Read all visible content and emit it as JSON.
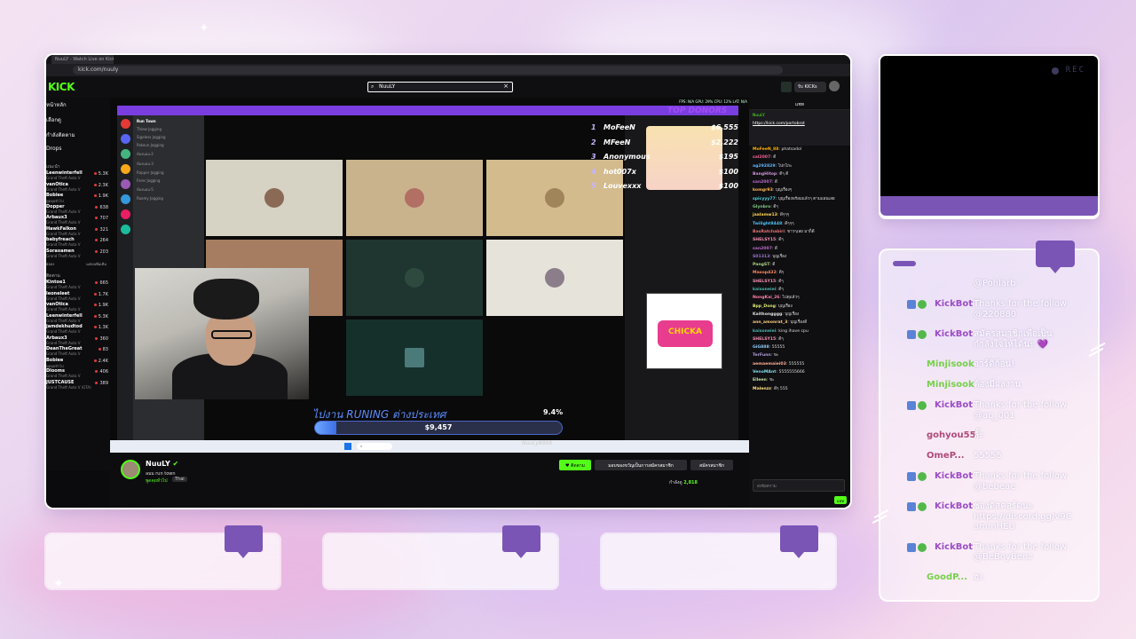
{
  "browser": {
    "tab_title": "NuuLY - Watch Live on Kick",
    "url": "kick.com/nuuly"
  },
  "kick": {
    "logo": "KICK",
    "search_value": "NuuLY",
    "join_label": "รับ KICKs"
  },
  "sidebar": {
    "nav": [
      "หน้าหลัก",
      "เลือกดู",
      "กำลังติดตาม",
      "Drops"
    ],
    "section_recommended": "แนะนำ",
    "channels_top": [
      {
        "name": "Leenwinterfell",
        "game": "Grand Theft Auto V",
        "count": "5.3K"
      },
      {
        "name": "vanOtica",
        "game": "Grand Theft Auto V",
        "count": "2.3K"
      },
      {
        "name": "Bobiee",
        "game": "พูดคุยทั่วไป",
        "count": "1.9K"
      },
      {
        "name": "Dopper",
        "game": "Grand Theft Auto V",
        "count": "638"
      },
      {
        "name": "Arbaux3",
        "game": "Grand Theft Auto V",
        "count": "707"
      },
      {
        "name": "HawkFalkon",
        "game": "Grand Theft Auto V",
        "count": "321"
      },
      {
        "name": "babyfreach",
        "game": "Grand Theft Auto V",
        "count": "264"
      },
      {
        "name": "Soraxamen",
        "game": "Grand Theft Auto V",
        "count": "203"
      }
    ],
    "show_more": "แสดงเพิ่มเติม",
    "show_less": "ย่อลง",
    "section_following": "ติดตาม",
    "channels_bottom": [
      {
        "name": "Kintoe1",
        "game": "Grand Theft Auto V",
        "count": "665"
      },
      {
        "name": "leoneleet",
        "game": "Grand Theft Auto V",
        "count": "1.7K"
      },
      {
        "name": "vanOtica",
        "game": "Grand Theft Auto V",
        "count": "1.9K"
      },
      {
        "name": "Leenwinterfell",
        "game": "Grand Theft Auto V",
        "count": "5.3K"
      },
      {
        "name": "jamdekhudtod",
        "game": "Grand Theft Auto V",
        "count": "1.3K"
      },
      {
        "name": "Arbaux3",
        "game": "Grand Theft Auto V",
        "count": "360"
      },
      {
        "name": "DeanTheGreat",
        "game": "Grand Theft Auto V",
        "count": "83"
      },
      {
        "name": "Bobiee",
        "game": "พูดคุยทั่วไป",
        "count": "2.4K"
      },
      {
        "name": "Dlooms",
        "game": "Grand Theft Auto V",
        "count": "406"
      },
      {
        "name": "JUSTCAUSE",
        "game": "Grand Theft Auto V (GTA)",
        "count": "389"
      }
    ]
  },
  "stream": {
    "top_donors_title": "TOP DONORS",
    "donors": [
      {
        "rank": "1",
        "name": "MoFeeN",
        "amount": "$6,555"
      },
      {
        "rank": "2",
        "name": "MFeeN",
        "amount": "$2,222"
      },
      {
        "rank": "3",
        "name": "Anonymous",
        "amount": "$195"
      },
      {
        "rank": "4",
        "name": "hot007x",
        "amount": "$100"
      },
      {
        "rank": "5",
        "name": "Louvexxx",
        "amount": "$100"
      }
    ],
    "discord_server": "Run Town",
    "discord_channels": [
      "Thiew Jogging",
      "Sigeless Jogging",
      "Pakoun Jogging",
      "ห้องนอน-2",
      "ห้องนอน-3",
      "Rapper Jogging",
      "Ferer Jogging",
      "ห้องนอน-5",
      "Roomy Jogging"
    ],
    "goal_label": "ไปงาน RUNING ต่างประเทศ",
    "goal_percent": "9.4%",
    "goal_fraction": 0.094,
    "goal_amount": "$9,457",
    "watermark": "NuuLy8888",
    "stats": "FPS: N/A   GPU: 29%   CPU: 12%   LAT: N/A",
    "chicka_logo": "CHICKA"
  },
  "channel": {
    "name": "NuuLY",
    "title": "ลมม run town",
    "category": "พูดคุยทั่วไป",
    "tag": "Thai",
    "follow_label": "ติดตาม",
    "gift_label": "มอบของขวัญเป็นการสมัครสมาชิก",
    "subscribe_label": "สมัครสมาชิก",
    "viewers_prefix": "กำลังดู",
    "viewers": "2,818"
  },
  "kick_chat": {
    "header": "แชท",
    "pinned_user": "NuuLY",
    "pinned_link": "https://kick.com/portobrot",
    "input_placeholder": "ส่งข้อความ",
    "send_label": "แชท",
    "messages": [
      {
        "user": "MoFeeN_88",
        "text": "phatsadol",
        "color": "#ffb300"
      },
      {
        "user": "sal2007",
        "text": "ดี",
        "color": "#f06292"
      },
      {
        "user": "ag292829",
        "text": "โปกโกะ",
        "color": "#64b5f6"
      },
      {
        "user": "BangHitop",
        "text": "ดีๆ ดี",
        "color": "#ce93d8"
      },
      {
        "user": "san2007",
        "text": "ดี",
        "color": "#ba68c8"
      },
      {
        "user": "komgr93",
        "text": "บุญเรื่องๆ",
        "color": "#ffb74d"
      },
      {
        "user": "spicyyy77",
        "text": "บุญเรื่องพร้อมแล้วๆ ตามแผนเลย",
        "color": "#4dd0e1"
      },
      {
        "user": "Glynbro",
        "text": "ดีๆ",
        "color": "#81c784"
      },
      {
        "user": "jaalamw13",
        "text": "ดีๆๆๆ",
        "color": "#ffd54f"
      },
      {
        "user": "Twilight8448",
        "text": "ดีๆๆๆ",
        "color": "#4fc3f7"
      },
      {
        "user": "BasRatchabiri",
        "text": "ขาวๆเลย มาก็ดี",
        "color": "#e57373"
      },
      {
        "user": "SHELSY15",
        "text": "ดีๆ",
        "color": "#f48fb1"
      },
      {
        "user": "san2007",
        "text": "ดี",
        "color": "#ba68c8"
      },
      {
        "user": "S01313",
        "text": "บุญเรื่อง",
        "color": "#9575cd"
      },
      {
        "user": "PangST",
        "text": "ดี",
        "color": "#aed581"
      },
      {
        "user": "Maxop432",
        "text": "ดีๆ",
        "color": "#ff8a65"
      },
      {
        "user": "SHELSY15",
        "text": "ดีๆ",
        "color": "#f48fb1"
      },
      {
        "user": "kaisoneiei",
        "text": "ดีๆ",
        "color": "#4db6ac"
      },
      {
        "user": "NongKai_26",
        "text": "ไปดุแล้วๆ",
        "color": "#ff80ab"
      },
      {
        "user": "Bpp_Dong",
        "text": "บุญเรื่อง",
        "color": "#dce775"
      },
      {
        "user": "Kaithongggg",
        "text": "บุญเรื่อง",
        "color": "#e0e0e0"
      },
      {
        "user": "ann_amonrat_3",
        "text": "บุญเรื่องดี",
        "color": "#ffcc80"
      },
      {
        "user": "kaisoneiei",
        "text": "king ihave cpu",
        "color": "#4db6ac"
      },
      {
        "user": "SHELSY15",
        "text": "ดีๆ",
        "color": "#f48fb1"
      },
      {
        "user": "GiG888",
        "text": "55555",
        "color": "#90caf9"
      },
      {
        "user": "TerFunn",
        "text": "ขะ",
        "color": "#b39ddb"
      },
      {
        "user": "aemaemaiei03",
        "text": "555555",
        "color": "#ffab91"
      },
      {
        "user": "VenoMAnt",
        "text": "5555555666",
        "color": "#80deea"
      },
      {
        "user": "Elleen",
        "text": "ขะ",
        "color": "#c5e1a5"
      },
      {
        "user": "Malenzz",
        "text": "ดีๆ 555",
        "color": "#ffe082"
      }
    ]
  },
  "overlay": {
    "rec_label": "REC",
    "chat": [
      {
        "user": "",
        "color": "",
        "lines": [
          "@Pohlarb"
        ],
        "badges": false
      },
      {
        "user": "KickBot",
        "color": "#9b4dc7",
        "lines": [
          "Thanks for the follow",
          "@220880"
        ],
        "badges": true
      },
      {
        "user": "KickBot",
        "color": "#9b4dc7",
        "lines": [
          "สมัครสมาชิกเพื่อเป็น",
          "กำลังใจให้ได้นะ 💜"
        ],
        "badges": true
      },
      {
        "user": "Minjisook",
        "color": "#76d14a",
        "lines": [
          "อาร์ดิก้อน!"
        ],
        "badges": false
      },
      {
        "user": "Minjisook",
        "color": "#76d14a",
        "lines": [
          "ต้องมีผลงาน"
        ],
        "badges": false
      },
      {
        "user": "KickBot",
        "color": "#9b4dc7",
        "lines": [
          "Thanks for the follow",
          "@aq_001"
        ],
        "badges": true
      },
      {
        "user": "gohyou55",
        "color": "#b04a7a",
        "lines": [
          "ลั๊ะ"
        ],
        "badges": false
      },
      {
        "user": "OmeP...",
        "color": "#b04a7a",
        "lines": [
          "55555"
        ],
        "badges": false
      },
      {
        "user": "KickBot",
        "color": "#9b4dc7",
        "lines": [
          "Thanks for the follow",
          "@bebeae"
        ],
        "badges": true
      },
      {
        "user": "KickBot",
        "color": "#9b4dc7",
        "lines": [
          "ช่องดิสคอร์ดนะ",
          "https://discord.gg/v9C",
          "ammHEU"
        ],
        "badges": true
      },
      {
        "user": "KickBot",
        "color": "#9b4dc7",
        "lines": [
          "Thanks for the follow",
          "@BeBoyBenz"
        ],
        "badges": true
      },
      {
        "user": "GoodP...",
        "color": "#76d14a",
        "lines": [
          "ฮะ"
        ],
        "badges": false
      }
    ]
  },
  "colors": {
    "kick_green": "#53fc18",
    "accent_purple": "#7a55b6",
    "donor_title": "#a34cf5"
  }
}
